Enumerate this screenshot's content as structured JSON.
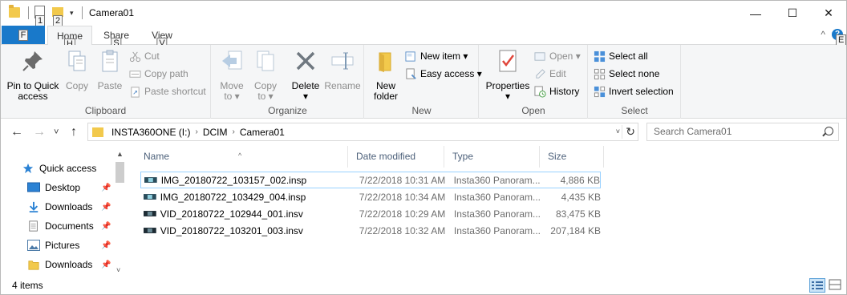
{
  "window": {
    "title": "Camera01",
    "controls": {
      "minimize": "—",
      "maximize": "☐",
      "close": "✕"
    }
  },
  "qat": {
    "keytip1": "1",
    "keytip2": "2",
    "dropdown": "▾"
  },
  "tabs": {
    "file": {
      "label": "F"
    },
    "items": [
      {
        "label": "Home",
        "keytip": "H"
      },
      {
        "label": "Share",
        "keytip": "S"
      },
      {
        "label": "View",
        "keytip": "V"
      }
    ],
    "right": {
      "collapse": "^",
      "help": "?",
      "help_keytip": "E"
    }
  },
  "ribbon": {
    "clipboard": {
      "label": "Clipboard",
      "pin": "Pin to Quick\naccess",
      "copy": "Copy",
      "paste": "Paste",
      "cut": "Cut",
      "copy_path": "Copy path",
      "paste_shortcut": "Paste shortcut"
    },
    "organize": {
      "label": "Organize",
      "move_to": "Move\nto ▾",
      "copy_to": "Copy\nto ▾",
      "delete": "Delete\n▾",
      "rename": "Rename"
    },
    "new": {
      "label": "New",
      "new_folder": "New\nfolder",
      "new_item": "New item ▾",
      "easy_access": "Easy access ▾"
    },
    "open": {
      "label": "Open",
      "properties": "Properties\n▾",
      "open": "Open ▾",
      "edit": "Edit",
      "history": "History"
    },
    "select": {
      "label": "Select",
      "select_all": "Select all",
      "select_none": "Select none",
      "invert": "Invert selection"
    }
  },
  "address": {
    "back": "←",
    "forward": "→",
    "recent": "˅",
    "up": "↑",
    "crumbs": [
      "INSTA360ONE (I:)",
      "DCIM",
      "Camera01"
    ],
    "crumb_sep": "›",
    "dropdown": "˅",
    "refresh": "↻",
    "search_placeholder": "Search Camera01"
  },
  "navpane": {
    "items": [
      {
        "label": "Quick access",
        "icon": "star-icon",
        "pinned": false
      },
      {
        "label": "Desktop",
        "icon": "desktop-icon",
        "pinned": true
      },
      {
        "label": "Downloads",
        "icon": "download-icon",
        "pinned": true
      },
      {
        "label": "Documents",
        "icon": "documents-icon",
        "pinned": true
      },
      {
        "label": "Pictures",
        "icon": "pictures-icon",
        "pinned": true
      },
      {
        "label": "Downloads",
        "icon": "folder-icon",
        "pinned": true
      }
    ],
    "pin_glyph": "📌",
    "scroll_up": "▲",
    "scroll_down": "˅"
  },
  "columns": {
    "name": "Name",
    "date": "Date modified",
    "type": "Type",
    "size": "Size",
    "sort_caret": "^"
  },
  "files": [
    {
      "name": "IMG_20180722_103157_002.insp",
      "date": "7/22/2018 10:31 AM",
      "type": "Insta360 Panoram...",
      "size": "4,886 KB",
      "kind": "insp"
    },
    {
      "name": "IMG_20180722_103429_004.insp",
      "date": "7/22/2018 10:34 AM",
      "type": "Insta360 Panoram...",
      "size": "4,435 KB",
      "kind": "insp"
    },
    {
      "name": "VID_20180722_102944_001.insv",
      "date": "7/22/2018 10:29 AM",
      "type": "Insta360 Panoram...",
      "size": "83,475 KB",
      "kind": "insv"
    },
    {
      "name": "VID_20180722_103201_003.insv",
      "date": "7/22/2018 10:32 AM",
      "type": "Insta360 Panoram...",
      "size": "207,184 KB",
      "kind": "insv"
    }
  ],
  "status": {
    "count": "4 items"
  },
  "colors": {
    "accent": "#1979ca",
    "folder": "#f2c94c",
    "selection_border": "#99d1ff"
  }
}
